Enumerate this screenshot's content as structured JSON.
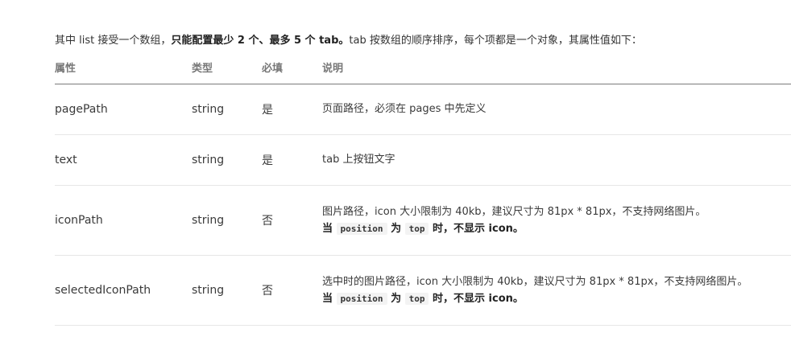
{
  "intro": {
    "part1": "其中 list 接受一个数组，",
    "bold": "只能配置最少 2 个、最多 5 个 tab。",
    "part2": "tab 按数组的顺序排序，每个项都是一个对象，其属性值如下："
  },
  "table": {
    "headers": {
      "name": "属性",
      "type": "类型",
      "required": "必填",
      "description": "说明"
    },
    "rows": [
      {
        "name": "pagePath",
        "type": "string",
        "required": "是",
        "description": "页面路径，必须在 pages 中先定义"
      },
      {
        "name": "text",
        "type": "string",
        "required": "是",
        "description": "tab 上按钮文字"
      },
      {
        "name": "iconPath",
        "type": "string",
        "required": "否",
        "description": "图片路径，icon 大小限制为 40kb，建议尺寸为 81px * 81px，不支持网络图片。",
        "note": {
          "prefix": "当",
          "code1": "position",
          "middle": "为",
          "code2": "top",
          "suffix": "时，不显示 icon。"
        }
      },
      {
        "name": "selectedIconPath",
        "type": "string",
        "required": "否",
        "description": "选中时的图片路径，icon 大小限制为 40kb，建议尺寸为 81px * 81px，不支持网络图片。",
        "note": {
          "prefix": "当",
          "code1": "position",
          "middle": "为",
          "code2": "top",
          "suffix": "时，不显示 icon。"
        }
      }
    ]
  }
}
